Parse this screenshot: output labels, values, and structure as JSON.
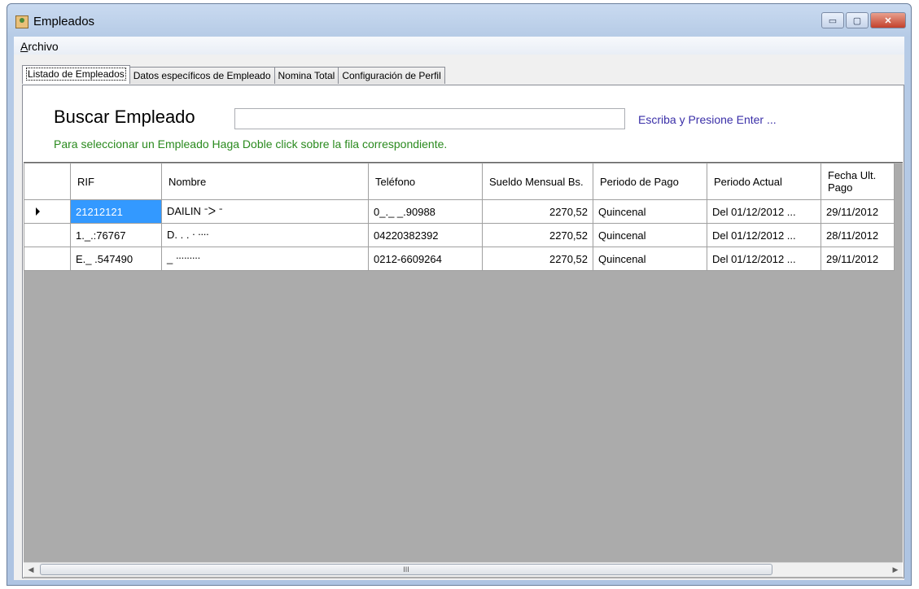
{
  "window": {
    "title": "Empleados",
    "controls": [
      "minimize-icon",
      "maximize-icon",
      "close-icon"
    ],
    "close_glyph": "✕",
    "minimize_glyph": "▭",
    "maximize_glyph": "▢"
  },
  "menu": {
    "archivo_first": "A",
    "archivo_rest": "rchivo"
  },
  "tabs": [
    {
      "label": "Listado de Empleados",
      "active": true
    },
    {
      "label": "Datos específicos de Empleado",
      "active": false
    },
    {
      "label": "Nomina Total",
      "active": false
    },
    {
      "label": "Configuración de Perfil",
      "active": false
    }
  ],
  "search": {
    "label": "Buscar Empleado",
    "value": "",
    "hint": "Escriba y Presione Enter ...",
    "instruction": "Para seleccionar un Empleado Haga Doble click sobre la fila correspondiente."
  },
  "grid": {
    "columns": [
      "RIF",
      "Nombre",
      "Teléfono",
      "Sueldo Mensual Bs.",
      "Periodo de Pago",
      "Periodo Actual",
      "Fecha Ult. Pago"
    ],
    "rows": [
      {
        "rif": "21212121",
        "nombre": "DAILIN  ᐨᐳ  ᐨ",
        "telefono": "0_._ _.90988",
        "sueldo": "2270,52",
        "periodo_pago": "Quincenal",
        "periodo_actual": "Del 01/12/2012 ...",
        "fecha_ult_pago": "29/11/2012"
      },
      {
        "rif": "1._.:76767",
        "nombre": "D. . . ᐧ ᐧᐧᐧᐧ",
        "telefono": "04220382392",
        "sueldo": "2270,52",
        "periodo_pago": "Quincenal",
        "periodo_actual": "Del 01/12/2012 ...",
        "fecha_ult_pago": "28/11/2012"
      },
      {
        "rif": "E._ .547490",
        "nombre": "_  ᐧᐧᐧᐧᐧᐧᐧᐧᐧ",
        "telefono": "0212-6609264",
        "sueldo": "2270,52",
        "periodo_pago": "Quincenal",
        "periodo_actual": "Del 01/12/2012 ...",
        "fecha_ult_pago": "29/11/2012"
      }
    ],
    "selected_row": 0,
    "scroll_thumb_glyph": "III",
    "scroll_left_glyph": "◀",
    "scroll_right_glyph": "▶"
  },
  "colors": {
    "selection": "#3399ff",
    "hint_text": "#3a2fa8",
    "instruction_text": "#2a8a1e"
  }
}
